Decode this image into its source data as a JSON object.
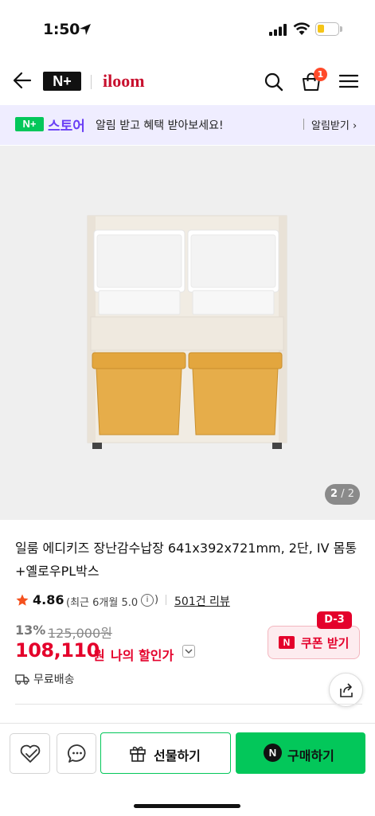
{
  "status_bar": {
    "time": "1:50"
  },
  "header": {
    "platform_logo": "N+",
    "brand_name": "iloom",
    "cart_count": "1"
  },
  "store_banner": {
    "store_logo": "N+",
    "store_name": "스토어",
    "message": "알림 받고 혜택 받아보세요!",
    "cta": "알림받기 ›"
  },
  "gallery": {
    "current": "2",
    "total": "/ 2"
  },
  "product": {
    "title": "일룸 에디키즈 장난감수납장 641x392x721mm, 2단, IV 몸통+옐로우PL박스",
    "rating": "4.86",
    "rating_recent": "(최근 6개월 5.0",
    "rating_recent_close": ")",
    "reviews": "501건 리뷰",
    "discount_rate": "13%",
    "original_price": "125,000원",
    "sale_price": "108,110",
    "currency": "원",
    "my_discount": "나의 할인가",
    "shipping": "무료배송"
  },
  "coupon": {
    "tag": "D-3",
    "label": "쿠폰 받기"
  },
  "bottom_bar": {
    "gift_label": "선물하기",
    "buy_label": "구매하기",
    "buy_icon": "N"
  },
  "icons": [
    "location-arrow-icon",
    "signal-icon",
    "wifi-icon",
    "battery-icon",
    "back-arrow-icon",
    "search-icon",
    "shopping-bag-icon",
    "menu-icon",
    "info-icon",
    "star-icon",
    "chevron-down-icon",
    "truck-icon",
    "share-icon",
    "heart-check-icon",
    "chat-icon",
    "gift-icon",
    "coupon-icon"
  ],
  "colors": {
    "brand_red": "#e4002b",
    "naver_green": "#03c75a",
    "store_purple": "#6a3ff5",
    "banner_bg": "#efedff"
  }
}
